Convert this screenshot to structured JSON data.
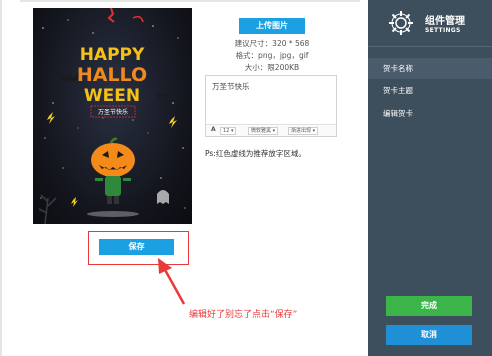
{
  "card": {
    "line1": "HAPPY",
    "line2": "HALLO",
    "line3": "WEEN",
    "banner_text": "万圣节快乐"
  },
  "upload": {
    "button_label": "上传图片",
    "size_spec": "建议尺寸：320 * 568",
    "format_spec": "格式：png，jpg，gif",
    "filesize_spec": "大小：限200KB"
  },
  "editor": {
    "text": "万圣节快乐",
    "font_size": "12",
    "font_name": "微软雅黑",
    "font_effect": "渐进出现"
  },
  "hint": "Ps:红色虚线为推荐放字区域。",
  "save_label": "保存",
  "annotation": "编辑好了别忘了点击“保存”",
  "sidebar": {
    "title": "组件管理",
    "subtitle": "SETTINGS",
    "items": [
      {
        "label": "贺卡名称"
      },
      {
        "label": "贺卡主题"
      },
      {
        "label": "编辑贺卡"
      }
    ],
    "done_label": "完成",
    "cancel_label": "取消"
  },
  "colors": {
    "primary_blue": "#1ba1e2",
    "sidebar_bg": "#3d4e5c",
    "done_green": "#3bb54a",
    "cancel_blue": "#1f8fd6",
    "annotation_red": "#e83a3a"
  }
}
